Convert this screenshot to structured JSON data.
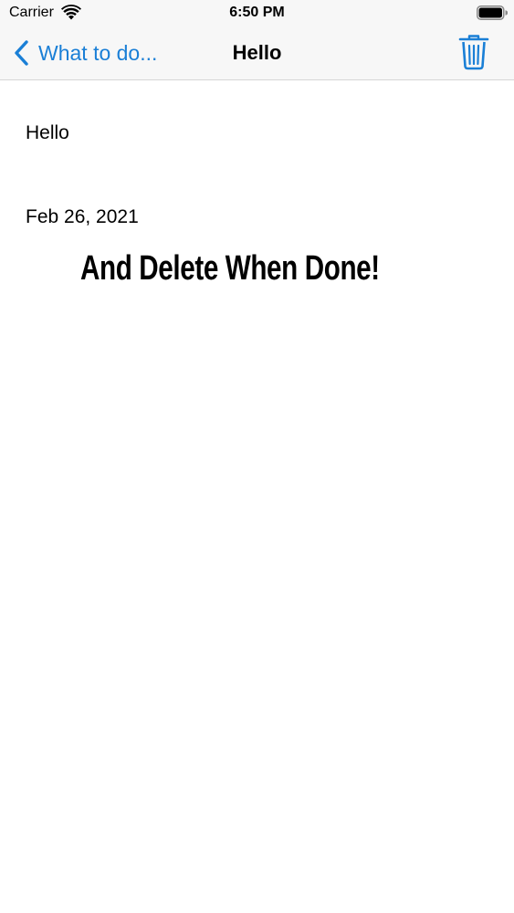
{
  "status_bar": {
    "carrier": "Carrier",
    "time": "6:50 PM"
  },
  "nav": {
    "back_label": "What to do...",
    "title": "Hello",
    "trash_icon": "trash-icon",
    "accent_color": "#1a7fd6"
  },
  "note": {
    "text": "Hello",
    "date": "Feb 26, 2021"
  },
  "banner": {
    "text": "And Delete When Done!"
  }
}
